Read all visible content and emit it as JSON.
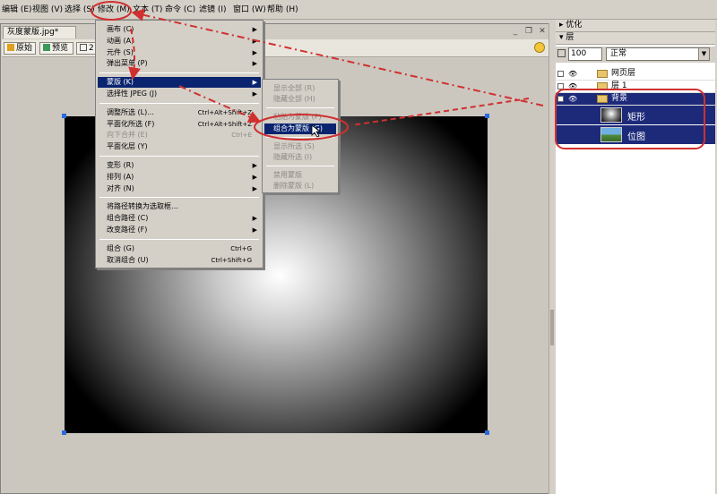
{
  "menubar": {
    "items": [
      "编辑 (E)",
      "视图 (V)",
      "选择 (S)",
      "修改 (M)",
      "文本 (T)",
      "命令 (C)",
      "滤镜 (I)",
      "窗口 (W)",
      "帮助 (H)"
    ]
  },
  "document": {
    "tab_title": "灰度蒙版.jpg*",
    "view_tabs": [
      "原始",
      "预览",
      "2"
    ]
  },
  "modify_menu": {
    "items": [
      {
        "label": "画布 (C)",
        "submenu": true
      },
      {
        "label": "动画 (A)",
        "submenu": true
      },
      {
        "label": "元件 (S)",
        "submenu": true
      },
      {
        "label": "弹出菜单 (P)",
        "submenu": true
      },
      {
        "label": "蒙版 (K)",
        "submenu": true,
        "highlighted": true
      },
      {
        "label": "选择性 JPEG (J)",
        "submenu": true
      },
      {
        "label": "调整所选 (L)...",
        "shortcut": "Ctrl+Alt+Shift+Z"
      },
      {
        "label": "平面化所选 (F)",
        "shortcut": "Ctrl+Alt+Shift+Z"
      },
      {
        "label": "向下合并 (E)",
        "shortcut": "Ctrl+E",
        "disabled": true
      },
      {
        "label": "平面化层 (Y)"
      },
      {
        "label": "变形 (R)",
        "submenu": true
      },
      {
        "label": "排列 (A)",
        "submenu": true
      },
      {
        "label": "对齐 (N)",
        "submenu": true
      },
      {
        "label": "将路径转换为选取框…"
      },
      {
        "label": "组合路径 (C)",
        "submenu": true
      },
      {
        "label": "改变路径 (F)",
        "submenu": true
      },
      {
        "label": "组合 (G)",
        "shortcut": "Ctrl+G"
      },
      {
        "label": "取消组合 (U)",
        "shortcut": "Ctrl+Shift+G"
      }
    ]
  },
  "mask_submenu": {
    "items": [
      {
        "label": "显示全部 (R)",
        "disabled": true
      },
      {
        "label": "隐藏全部 (H)",
        "disabled": true
      },
      {
        "label": "粘贴为蒙版 (P)",
        "disabled": true
      },
      {
        "label": "组合为蒙版 (G)",
        "highlighted": true
      },
      {
        "label": "显示所选 (S)",
        "disabled": true
      },
      {
        "label": "隐藏所选 (I)",
        "disabled": true
      },
      {
        "label": "禁用蒙版",
        "disabled": true
      },
      {
        "label": "删除蒙版 (L)",
        "disabled": true
      }
    ]
  },
  "right_panel": {
    "optimize_label": "优化",
    "layers_label": "层",
    "opacity": "100",
    "blend_mode": "正常",
    "layers": [
      "网页层",
      "层 1",
      "背景"
    ],
    "sub_objects": [
      "矩形",
      "位图"
    ]
  },
  "colors": {
    "menu_highlight": "#0a2470",
    "annotation_red": "#d03030",
    "handle_blue": "#2a6ae0"
  }
}
